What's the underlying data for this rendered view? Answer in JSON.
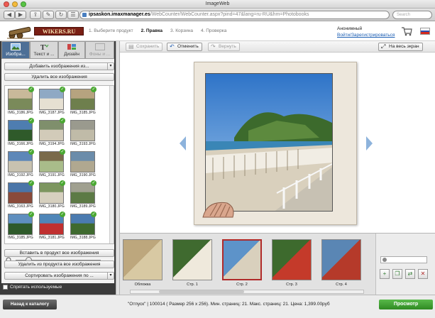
{
  "window": {
    "title": "ImageWeb",
    "url_host": "ipsaskon.imaxmanager.es",
    "url_path": "/WebCounter/WebCounter.aspx?pind=47&lang=ru-RU&hm=Photobooks",
    "search_placeholder": "Search"
  },
  "header": {
    "logo_text": "WIKERS.RU",
    "steps": [
      {
        "label": "1. Выберите продукт",
        "active": false
      },
      {
        "label": "2. Правка",
        "active": true
      },
      {
        "label": "3. Корзина",
        "active": false
      },
      {
        "label": "4. Проверка",
        "active": false
      }
    ],
    "user_name": "Анонимный",
    "login_link": "Войти/Зарегистрироваться"
  },
  "sidebar": {
    "tabs": [
      {
        "label": "Изобра...",
        "icon": "image-icon",
        "active": true
      },
      {
        "label": "Текст и ...",
        "icon": "text-icon",
        "active": false
      },
      {
        "label": "Дизайн",
        "icon": "design-icon",
        "active": false
      },
      {
        "label": "Фоны и ...",
        "icon": "background-icon",
        "active": false
      }
    ],
    "add_images_label": "Добавить изображения из...",
    "delete_all_label": "Удалить все изображения",
    "thumbnails": [
      {
        "caption": "IMG_3186.JPG",
        "checked": true
      },
      {
        "caption": "IMG_3187.JPG",
        "checked": true
      },
      {
        "caption": "IMG_3185.JPG",
        "checked": true
      },
      {
        "caption": "IMG_3166.JPG",
        "checked": true
      },
      {
        "caption": "IMG_3194.JPG",
        "checked": true
      },
      {
        "caption": "IMG_3193.JPG",
        "checked": false
      },
      {
        "caption": "IMG_3192.JPG",
        "checked": true
      },
      {
        "caption": "IMG_3191.JPG",
        "checked": true
      },
      {
        "caption": "IMG_3190.JPG",
        "checked": false
      },
      {
        "caption": "IMG_3163.JPG",
        "checked": true
      },
      {
        "caption": "IMG_3180.JPG",
        "checked": true
      },
      {
        "caption": "IMG_3189.JPG",
        "checked": true
      },
      {
        "caption": "IMG_3185.JPG",
        "checked": true
      },
      {
        "caption": "IMG_3181.JPG",
        "checked": true
      },
      {
        "caption": "IMG_3188.JPG",
        "checked": true
      }
    ],
    "insert_all_label": "Вставить в продукт все изображения",
    "remove_all_label": "Удалить из продукта все изображения",
    "sort_label": "Сортировать изображения по ...",
    "hide_used_label": "Спрятать используемые"
  },
  "editor": {
    "save_label": "Сохранить",
    "undo_label": "Отменить",
    "redo_label": "Вернуть",
    "fullscreen_label": "На весь экран"
  },
  "filmstrip": {
    "pages": [
      {
        "caption": "Обложка",
        "selected": false
      },
      {
        "caption": "Стр. 1",
        "selected": false
      },
      {
        "caption": "Стр. 2",
        "selected": true
      },
      {
        "caption": "Стр. 3",
        "selected": false
      },
      {
        "caption": "Стр. 4",
        "selected": false
      }
    ]
  },
  "bottom": {
    "back_label": "Назад к каталогу",
    "product_info": "\"Отпуск\" | 100014 ( Размер 256 x 256). Мин. страниц: 21. Макс. страниц: 21. Цена: 1,399.00руб",
    "preview_label": "Просмотр"
  }
}
